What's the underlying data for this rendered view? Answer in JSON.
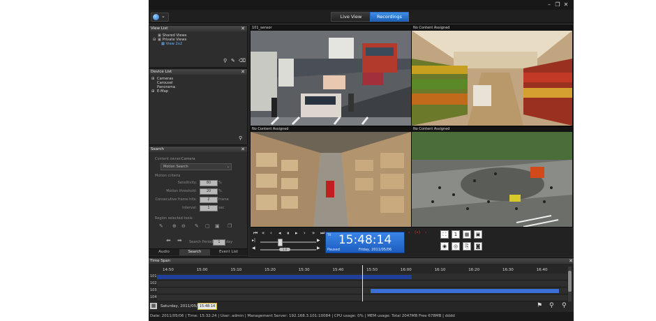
{
  "app": {
    "mode_tabs": {
      "live": "Live View",
      "recordings": "Recordings"
    },
    "window": {
      "min": "–",
      "restore": "❐",
      "close": "✕"
    }
  },
  "view_list": {
    "title": "View List",
    "items": [
      {
        "expand": "",
        "label": "Shared Views"
      },
      {
        "expand": "⊟",
        "label": "Private Views"
      },
      {
        "expand": "",
        "label": "View 2x2"
      }
    ]
  },
  "device_list": {
    "title": "Device List",
    "items": [
      {
        "expand": "⊞",
        "label": "Cameras"
      },
      {
        "expand": "",
        "label": "Carousel"
      },
      {
        "expand": "",
        "label": "Panorama"
      },
      {
        "expand": "⊞",
        "label": "E-Map"
      }
    ]
  },
  "search": {
    "title": "Search",
    "content_owner_label": "Content owner:",
    "content_owner_value": "Camera",
    "search_type": "Motion Search",
    "motion_criteria_label": "Motion criteria",
    "sensitivity_label": "Sensitivity:",
    "sensitivity_value": "80",
    "sensitivity_unit": "%",
    "threshold_label": "Motion threshold:",
    "threshold_value": "20",
    "threshold_unit": "%",
    "consecutive_label": "Consecutive frame hits:",
    "consecutive_value": "2",
    "consecutive_unit": "frame",
    "interval_label": "Interval:",
    "interval_value": "1",
    "interval_unit": "sec",
    "region_label": "Region selected tools:",
    "period_label": "Search Period:",
    "period_value": "1",
    "period_unit": "day",
    "tabs": [
      "Audio",
      "Search",
      "Event List"
    ]
  },
  "video": {
    "tiles": [
      {
        "label": "101_sensor"
      },
      {
        "label": "No Content Assigned"
      },
      {
        "label": "No Content Assigned"
      },
      {
        "label": "No Content Assigned"
      }
    ]
  },
  "playback": {
    "time": "15:48:14",
    "date": "Friday, 2011/05/06",
    "state": "Paused",
    "tz": "TX",
    "speed_label": "1.0",
    "layout_1x1": "1"
  },
  "timeline": {
    "title": "Time Span",
    "ticks": [
      "14:50",
      "15:00",
      "15:10",
      "15:20",
      "15:30",
      "15:40",
      "15:50",
      "16:00",
      "16:10",
      "16:20",
      "16:30",
      "16:40"
    ],
    "rows": [
      "101",
      "102",
      "103",
      "104"
    ],
    "segments": [
      {
        "row": 0,
        "start": 0.0,
        "end": 0.62,
        "color": "#1f3f9a"
      },
      {
        "row": 2,
        "start": 0.52,
        "end": 0.98,
        "color": "#3a6fd8"
      }
    ],
    "cursor_pos": 0.5,
    "date_label": "Saturday, 2011/05/06",
    "time_box": "15:48:14"
  },
  "statusbar": "Date: 2011/05/06  |  Time: 15:32:24  |  User: admin  |  Management Server: 192.168.3.101:10084  |  CPU usage: 0%  |  MEM usage: Total 2047MB  Free 678MB  |  dddd"
}
